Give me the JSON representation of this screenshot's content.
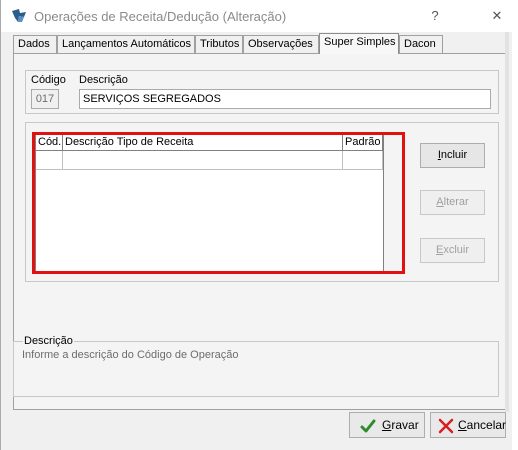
{
  "window": {
    "title": "Operações de Receita/Dedução (Alteração)",
    "help_glyph": "?",
    "close_glyph": "✕"
  },
  "tabs": [
    {
      "label": "Dados"
    },
    {
      "label": "Lançamentos Automáticos"
    },
    {
      "label": "Tributos"
    },
    {
      "label": "Observações"
    },
    {
      "label": "Super Simples",
      "active": true
    },
    {
      "label": "Dacon"
    }
  ],
  "form": {
    "codigo_label": "Código",
    "codigo_value": "017",
    "descricao_label": "Descrição",
    "descricao_value": "SERVIÇOS SEGREGADOS"
  },
  "grid": {
    "columns": [
      "Cód.",
      "Descrição Tipo de Receita",
      "Padrão"
    ],
    "rows": []
  },
  "actions": {
    "incluir_first": "I",
    "incluir_rest": "ncluir",
    "alterar_first": "A",
    "alterar_rest": "lterar",
    "excluir_first": "E",
    "excluir_rest": "xcluir"
  },
  "help": {
    "legend": "Descrição",
    "text": "Informe a descrição do Código de Operação"
  },
  "footer": {
    "gravar_first": "G",
    "gravar_rest": "ravar",
    "cancelar_first": "C",
    "cancelar_rest": "ancelar"
  },
  "colors": {
    "highlight": "#e31010",
    "ok_icon": "#2e8b2e",
    "cancel_icon": "#d42020"
  }
}
